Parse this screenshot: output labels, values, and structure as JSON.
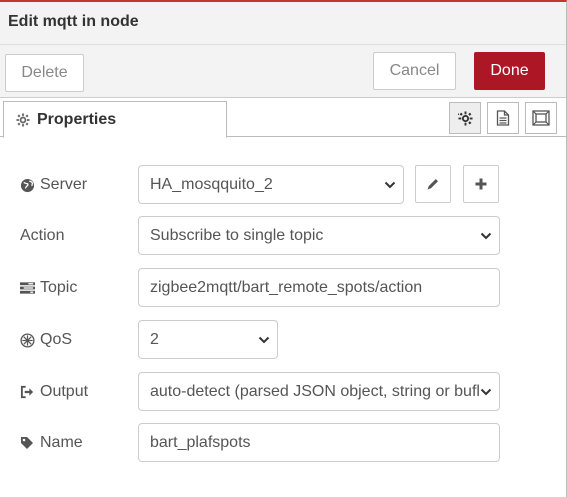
{
  "header": {
    "title": "Edit mqtt in node"
  },
  "toolbar": {
    "delete_label": "Delete",
    "cancel_label": "Cancel",
    "done_label": "Done"
  },
  "tabs": [
    {
      "label": "Properties",
      "icon": "gear-icon"
    }
  ],
  "tab_buttons": [
    "gear-icon",
    "document-icon",
    "frame-icon"
  ],
  "form": {
    "server": {
      "label": "Server",
      "icon": "globe-icon",
      "value": "HA_mosqquito_2",
      "edit_icon": "pencil-icon",
      "add_icon": "plus-icon"
    },
    "action": {
      "label": "Action",
      "value": "Subscribe to single topic"
    },
    "topic": {
      "label": "Topic",
      "icon": "tasks-icon",
      "value": "zigbee2mqtt/bart_remote_spots/action"
    },
    "qos": {
      "label": "QoS",
      "icon": "empire-icon",
      "value": "2"
    },
    "output": {
      "label": "Output",
      "icon": "sign-out-icon",
      "value": "auto-detect (parsed JSON object, string or bufl"
    },
    "name": {
      "label": "Name",
      "icon": "tag-icon",
      "value": "bart_plafspots"
    }
  },
  "colors": {
    "accent": "#c0392b",
    "done_button": "#ad1625",
    "header_bg": "#f3f3f3"
  }
}
